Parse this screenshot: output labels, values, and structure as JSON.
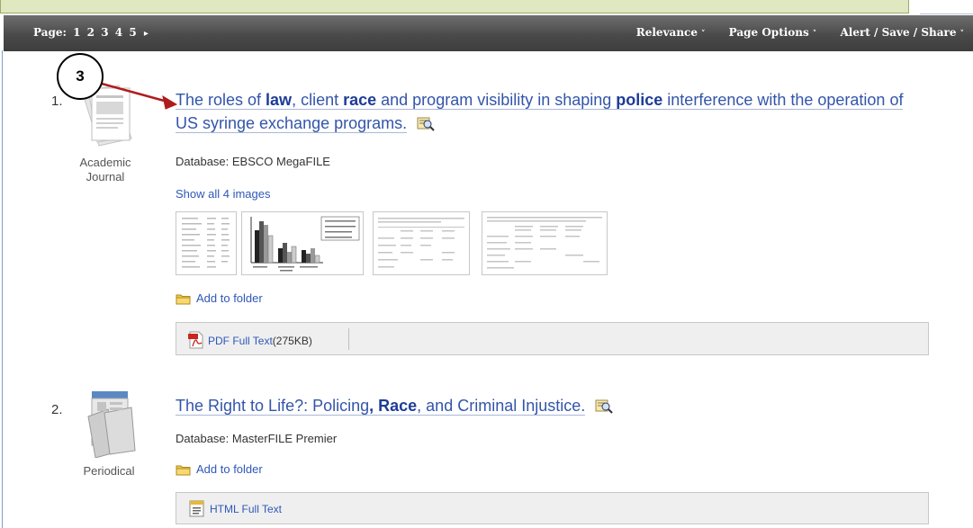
{
  "toolbar": {
    "page_label": "Page:",
    "pages": [
      "1",
      "2",
      "3",
      "4",
      "5"
    ],
    "next_arrow": "▸",
    "relevance": "Relevance",
    "page_options": "Page Options",
    "alert_save_share": "Alert / Save / Share",
    "chevron": "˅"
  },
  "callout": {
    "number": "3"
  },
  "results": [
    {
      "number": "1.",
      "pub_type": [
        "Academic",
        "Journal"
      ],
      "title_parts": {
        "t1": "The roles of ",
        "b1": "law",
        "t2": ", client ",
        "b2": "race",
        "t3": " and program visibility in shaping ",
        "b3": "police",
        "t4": " interference with the operation of US syringe exchange programs."
      },
      "database": "Database: EBSCO MegaFILE",
      "show_images": "Show all 4 images",
      "add_to_folder": "Add to folder",
      "fulltext_label": "PDF Full Text",
      "fulltext_size": "(275KB)"
    },
    {
      "number": "2.",
      "pub_type": [
        "Periodical"
      ],
      "title_parts": {
        "t1": "The Right to Life?: Policing",
        "b1": ", Race",
        "t2": ", and Criminal Injustice."
      },
      "database": "Database: MasterFILE Premier",
      "add_to_folder": "Add to folder",
      "fulltext_label": "HTML Full Text"
    }
  ],
  "colors": {
    "link": "#3355aa",
    "bold_link": "#1e3c96",
    "arrow": "#b01c1c",
    "toolbar": "#4a4a4a"
  }
}
